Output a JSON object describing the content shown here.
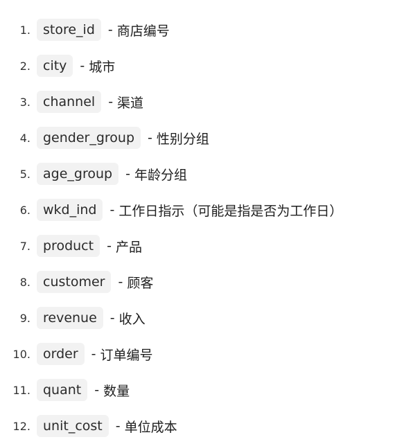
{
  "items": [
    {
      "number": "1.",
      "code": "store_id",
      "desc": "商店编号"
    },
    {
      "number": "2.",
      "code": "city",
      "desc": "城市"
    },
    {
      "number": "3.",
      "code": "channel",
      "desc": "渠道"
    },
    {
      "number": "4.",
      "code": "gender_group",
      "desc": "性别分组"
    },
    {
      "number": "5.",
      "code": "age_group",
      "desc": "年龄分组"
    },
    {
      "number": "6.",
      "code": "wkd_ind",
      "desc": "工作日指示（可能是指是否为工作日）"
    },
    {
      "number": "7.",
      "code": "product",
      "desc": "产品"
    },
    {
      "number": "8.",
      "code": "customer",
      "desc": "顾客"
    },
    {
      "number": "9.",
      "code": "revenue",
      "desc": "收入"
    },
    {
      "number": "10.",
      "code": "order",
      "desc": "订单编号"
    },
    {
      "number": "11.",
      "code": "quant",
      "desc": "数量"
    },
    {
      "number": "12.",
      "code": "unit_cost",
      "desc": "单位成本"
    }
  ],
  "separator": "-"
}
